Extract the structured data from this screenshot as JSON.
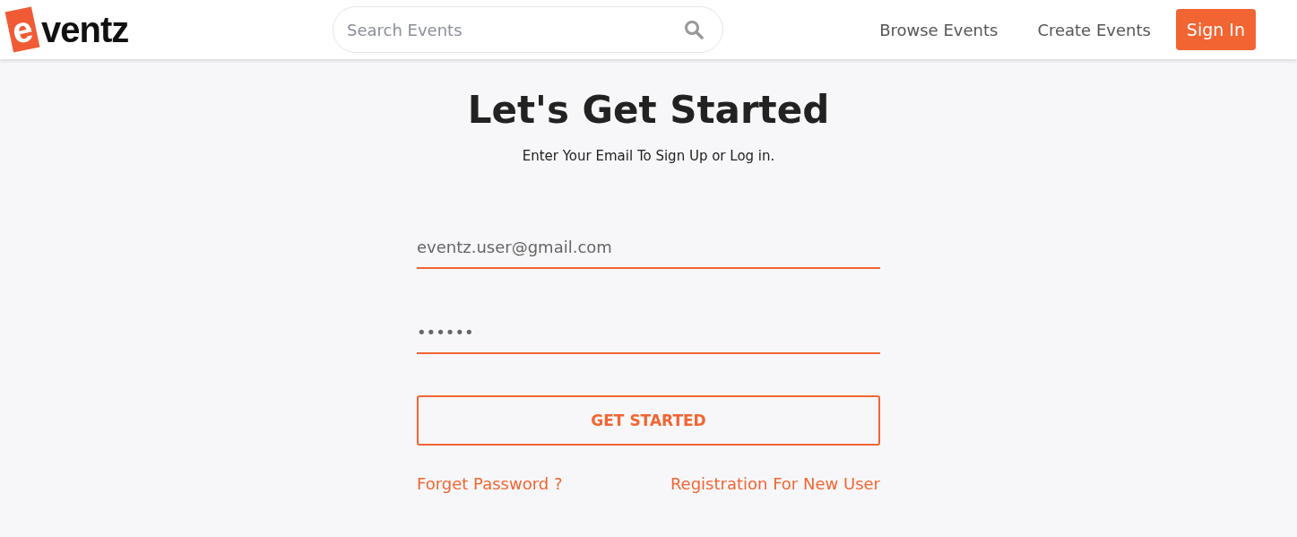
{
  "header": {
    "logo": {
      "mark": "e",
      "text": "ventz"
    },
    "search": {
      "placeholder": "Search Events"
    },
    "nav": [
      {
        "label": "Browse Events",
        "kind": "link"
      },
      {
        "label": "Create Events",
        "kind": "link"
      },
      {
        "label": "Sign In",
        "kind": "button"
      }
    ]
  },
  "form": {
    "title": "Let's Get Started",
    "subtitle": "Enter Your Email To Sign Up or Log in.",
    "email": {
      "value": "eventz.user@gmail.com"
    },
    "password": {
      "value": "••••••"
    },
    "submit": "GET STARTED",
    "links": [
      "Forget Password ?",
      "Registration For New User"
    ]
  }
}
